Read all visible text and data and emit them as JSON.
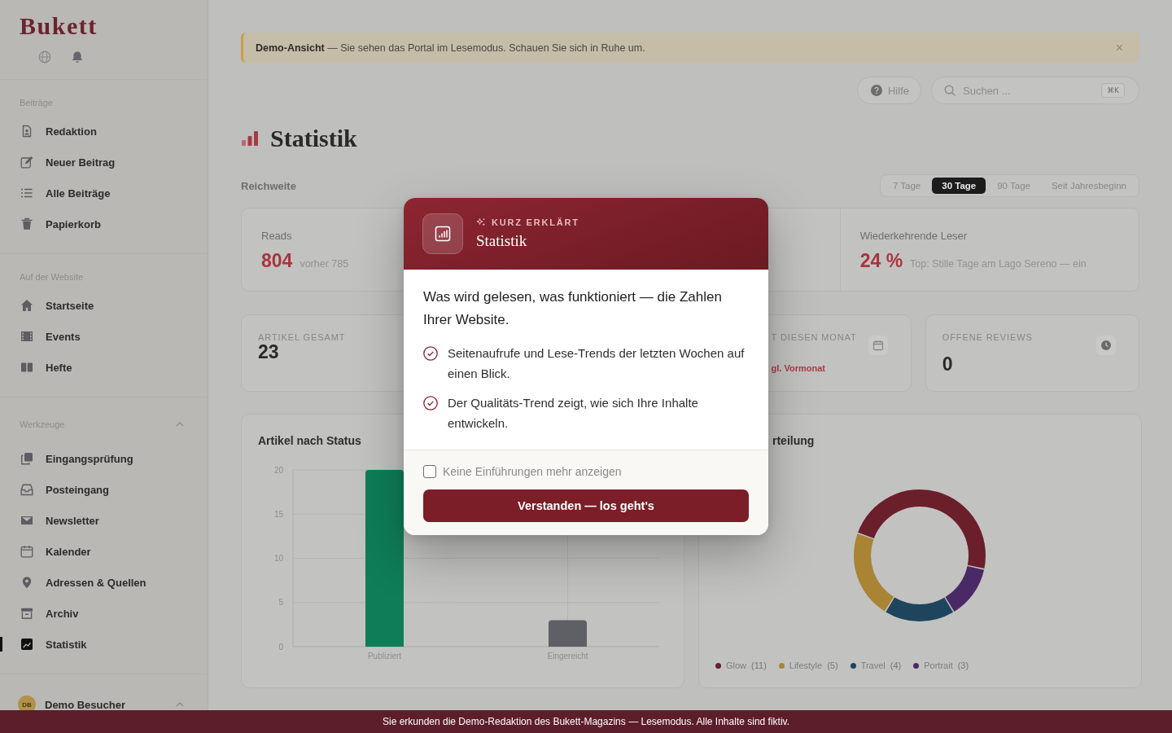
{
  "sidebar": {
    "logo": "Bukett",
    "sections": [
      {
        "title": "Beiträge",
        "items": [
          {
            "label": "Redaktion",
            "selected": false
          },
          {
            "label": "Neuer Beitrag",
            "selected": false
          },
          {
            "label": "Alle Beiträge",
            "selected": false
          },
          {
            "label": "Papierkorb",
            "selected": false
          }
        ]
      },
      {
        "title": "Auf der Website",
        "items": [
          {
            "label": "Startseite",
            "selected": false
          },
          {
            "label": "Events",
            "selected": false
          },
          {
            "label": "Hefte",
            "selected": false
          }
        ]
      },
      {
        "title": "Werkzeuge",
        "expanded": true,
        "items": [
          {
            "label": "Eingangsprüfung",
            "selected": false
          },
          {
            "label": "Posteingang",
            "selected": false
          },
          {
            "label": "Newsletter",
            "selected": false
          },
          {
            "label": "Kalender",
            "selected": false
          },
          {
            "label": "Adressen & Quellen",
            "selected": false
          },
          {
            "label": "Archiv",
            "selected": false
          },
          {
            "label": "Statistik",
            "selected": true
          }
        ]
      }
    ],
    "user": {
      "initials": "DB",
      "name": "Demo Besucher"
    }
  },
  "notice": {
    "text": "**Demo-Ansicht** — Sie sehen das Portal im Lesemodus. Schauen Sie sich in Ruhe um.",
    "close": "×"
  },
  "toolbar": {
    "help": "Hilfe",
    "search": {
      "placeholder": "Suchen ...",
      "shortcut": "⌘K"
    }
  },
  "page_title": "Statistik",
  "reach": {
    "title": "Reichweite",
    "ranges": [
      {
        "label": "7 Tage",
        "selected": false
      },
      {
        "label": "30 Tage",
        "selected": true
      },
      {
        "label": "90 Tage",
        "selected": false
      },
      {
        "label": "Seit Jahresbeginn",
        "selected": false
      }
    ],
    "metrics": [
      {
        "label": "Reads",
        "value": "804",
        "note": "vorher 785"
      },
      {
        "label": "Wiederkehrende Leser",
        "value": "24 %",
        "note": "Top: Stille Tage am Lago Sereno — ein"
      }
    ]
  },
  "stat_cards": [
    {
      "kind": "full",
      "label": "ARTIKEL GESAMT",
      "value": "23"
    },
    {
      "kind": "cut",
      "label": "T DIESEN MONAT",
      "note": "gl. Vormonat"
    },
    {
      "kind": "full",
      "label": "OFFENE REVIEWS",
      "value": "0"
    }
  ],
  "charts": [
    {
      "kind": "full",
      "chart_data": {
        "type": "bar",
        "title": "Artikel nach Status",
        "categories": [
          "Publiziert",
          "Eingereicht"
        ],
        "series": [
          {
            "color": "#0f7d58",
            "values": [
              20,
              null
            ]
          },
          {
            "color": "#5f5f66",
            "values": [
              null,
              3
            ]
          }
        ],
        "stacked": true,
        "grid": true,
        "ylim": [
          0,
          20
        ],
        "yticks": [
          0,
          5,
          10,
          15,
          20
        ]
      }
    },
    {
      "kind": "cut",
      "chart_data": {
        "type": "donut",
        "title": "rteilung",
        "categories": [
          "Glow",
          "Lifestyle",
          "Travel",
          "Portrait"
        ],
        "values": [
          11,
          5,
          4,
          3
        ],
        "colors": [
          "#6b1f2b",
          "#a88434",
          "#1f455e",
          "#4a2a66"
        ],
        "value_labels": [
          "(11)",
          "(5)",
          "(4)",
          "(3)"
        ],
        "legend": "bottom"
      }
    }
  ],
  "intro_dialog": {
    "eyebrow": "KURZ ERKLÄRT",
    "title": "Statistik",
    "lead": "Was wird gelesen, was funktioniert — die Zahlen Ihrer Website.",
    "points": [
      "Seitenaufrufe und Lese-Trends der letzten Wochen auf einen Blick.",
      "Der Qualitäts-Trend zeigt, wie sich Ihre Inhalte entwickeln."
    ],
    "opt_out": {
      "label": "Keine Einführungen mehr anzeigen",
      "checked": false
    },
    "confirm": "Verstanden — los geht's"
  },
  "status_bar": {
    "text": "Sie erkunden die Demo-Redaktion des Bukett-Magazins — Lesemodus. Alle Inhalte sind fiktiv."
  }
}
